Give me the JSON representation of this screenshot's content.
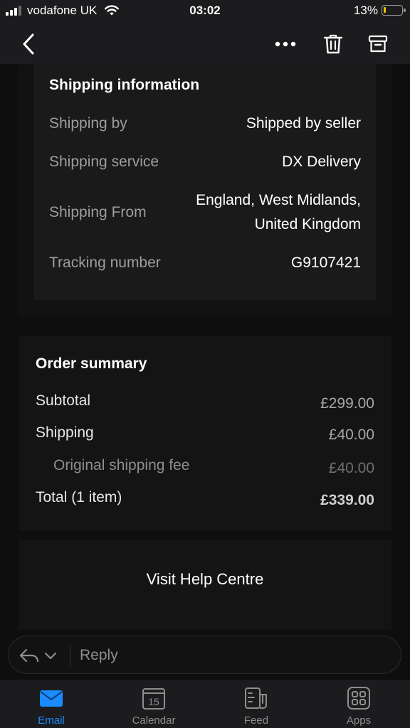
{
  "status_bar": {
    "carrier": "vodafone UK",
    "time": "03:02",
    "battery": "13%",
    "battery_level": 0.13,
    "battery_color": "#f2c200"
  },
  "nav": {
    "back_icon": "chevron-left-icon",
    "more_icon": "more-horizontal-icon",
    "delete_icon": "trash-icon",
    "archive_icon": "archive-icon"
  },
  "shipping": {
    "title": "Shipping information",
    "rows": [
      {
        "label": "Shipping by",
        "value": "Shipped by seller"
      },
      {
        "label": "Shipping service",
        "value": "DX Delivery"
      },
      {
        "label": "Shipping From",
        "value_lines": [
          "England, West Midlands,",
          "United Kingdom"
        ]
      },
      {
        "label": "Tracking number",
        "value": "G9107421"
      }
    ]
  },
  "order_summary": {
    "title": "Order summary",
    "rows": [
      {
        "label": "Subtotal",
        "value": "£299.00"
      },
      {
        "label": "Shipping",
        "value": "£40.00"
      },
      {
        "label": "Original shipping fee",
        "value": "£40.00"
      },
      {
        "label": "Total (1 item)",
        "value": "£339.00"
      }
    ]
  },
  "help": {
    "link": "Visit Help Centre"
  },
  "reply": {
    "icon": "reply-icon",
    "dropdown_icon": "chevron-down-icon",
    "placeholder": "Reply"
  },
  "tabs": [
    {
      "label": "Email",
      "icon": "email-icon",
      "active": true
    },
    {
      "label": "Calendar",
      "icon": "calendar-icon",
      "day": "15"
    },
    {
      "label": "Feed",
      "icon": "feed-icon"
    },
    {
      "label": "Apps",
      "icon": "apps-icon"
    }
  ],
  "colors": {
    "accent": "#1a8cff",
    "muted": "#8e8e8e"
  }
}
